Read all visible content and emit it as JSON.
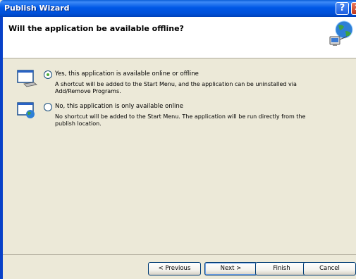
{
  "window": {
    "title": "Publish Wizard"
  },
  "titlebar": {
    "help_glyph": "?",
    "close_glyph": "✕"
  },
  "header": {
    "title": "Will the application be available offline?"
  },
  "options": [
    {
      "label": "Yes, this application is available online or offline",
      "description": "A shortcut will be added to the Start Menu, and the application can be uninstalled via Add/Remove Programs.",
      "selected": true
    },
    {
      "label": "No, this application is only available online",
      "description": "No shortcut will be added to the Start Menu. The application will be run directly from the publish location.",
      "selected": false
    }
  ],
  "buttons": {
    "previous": "< Previous",
    "next": "Next >",
    "finish": "Finish",
    "cancel": "Cancel"
  }
}
